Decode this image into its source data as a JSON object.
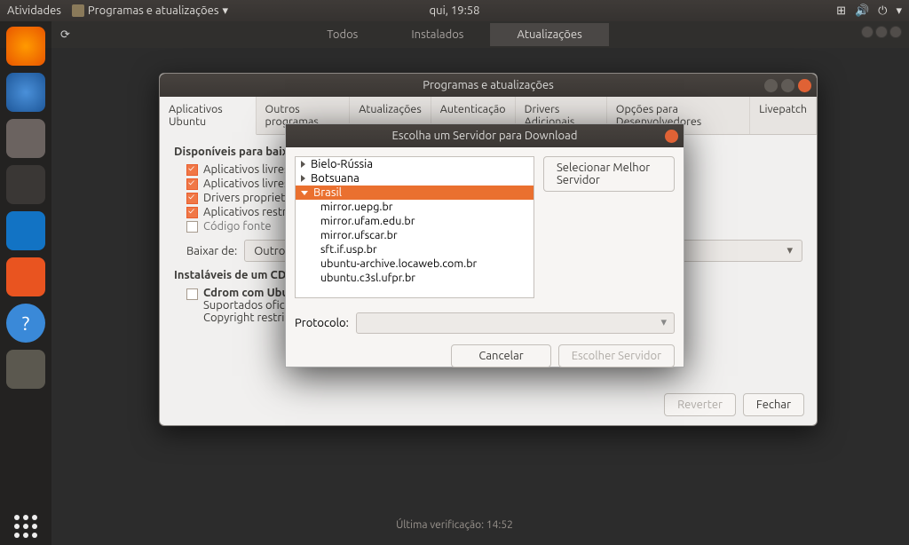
{
  "panel": {
    "activities": "Atividades",
    "app_name": "Programas e atualizações",
    "clock": "qui, 19:58"
  },
  "browser": {
    "tabs": {
      "all": "Todos",
      "installed": "Instalados",
      "updates": "Atualizações"
    }
  },
  "main_window": {
    "title": "Programas e atualizações",
    "tabs": [
      "Aplicativos Ubuntu",
      "Outros programas",
      "Atualizações",
      "Autenticação",
      "Drivers Adicionais",
      "Opções para Desenvolvedores",
      "Livepatch"
    ],
    "section_available": "Disponíveis para baixar",
    "checks": {
      "free": "Aplicativos livres de",
      "free2": "Aplicativos livres de",
      "proprietary": "Drivers proprietário",
      "restricted": "Aplicativos restritos",
      "source": "Código fonte"
    },
    "download_from": "Baixar de:",
    "download_value": "Outro...",
    "section_installable": "Instaláveis de um CD-R",
    "cdrom_title": "Cdrom com Ubuntu",
    "cdrom_line2": "Suportados oficialm",
    "cdrom_line3": "Copyright restrito",
    "revert": "Reverter",
    "close": "Fechar"
  },
  "modal": {
    "title": "Escolha um Servidor para Download",
    "best": "Selecionar Melhor Servidor",
    "countries": {
      "belarus": "Bielo-Rússia",
      "botswana": "Botsuana",
      "brazil": "Brasil"
    },
    "mirrors": [
      "mirror.uepg.br",
      "mirror.ufam.edu.br",
      "mirror.ufscar.br",
      "sft.if.usp.br",
      "ubuntu-archive.locaweb.com.br",
      "ubuntu.c3sl.ufpr.br"
    ],
    "protocol_label": "Protocolo:",
    "cancel": "Cancelar",
    "choose": "Escolher Servidor"
  },
  "status": "Última verificação: 14:52"
}
